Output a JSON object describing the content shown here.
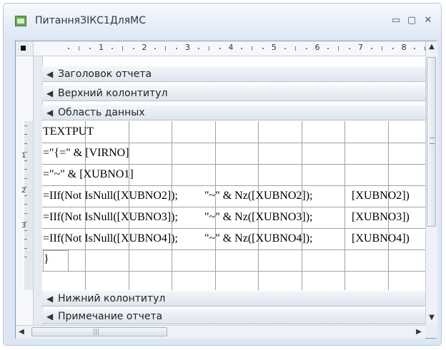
{
  "window": {
    "title": "ПитанняЗІКС1ДляМС",
    "buttons": {
      "minimize": "▭",
      "restore": "▢",
      "close": "✕"
    }
  },
  "ruler": {
    "h_numbers": [
      "1",
      "2",
      "3",
      "4",
      "5",
      "6",
      "7",
      "8"
    ],
    "v_numbers": [
      "1",
      "2",
      "3"
    ]
  },
  "sections": {
    "report_header": "Заголовок отчета",
    "page_header": "Верхний колонтитул",
    "detail": "Область данных",
    "page_footer": "Нижний колонтитул",
    "report_footer": "Примечание отчета"
  },
  "detail_rows": [
    {
      "name": "textput-row",
      "parts": [
        {
          "text": "TEXTPUT",
          "box": 0
        }
      ]
    },
    {
      "name": "virno-row",
      "parts": [
        {
          "text": "=\"{=\" & [VIRNO]",
          "box": 0
        }
      ]
    },
    {
      "name": "xubno1-row",
      "parts": [
        {
          "text": "=\"~\" & [XUBNO1]",
          "box": 0
        }
      ]
    },
    {
      "name": "xubno2-row",
      "parts": [
        {
          "text": "=IIf(Not IsNull([XUBNO2]);",
          "box": 0
        },
        {
          "text": "\"~\" & Nz([XUBNO2]);",
          "box": 1
        },
        {
          "text": "[XUBNO2])",
          "box": 2
        }
      ]
    },
    {
      "name": "xubno3-row",
      "parts": [
        {
          "text": "=IIf(Not IsNull([XUBNO3]);",
          "box": 0
        },
        {
          "text": "\"~\" & Nz([XUBNO3]);",
          "box": 1
        },
        {
          "text": "[XUBNO3])",
          "box": 2
        }
      ]
    },
    {
      "name": "xubno4-row",
      "parts": [
        {
          "text": "=IIf(Not IsNull([XUBNO4]);",
          "box": 0
        },
        {
          "text": "\"~\" & Nz([XUBNO4]);",
          "box": 1
        },
        {
          "text": "[XUBNO4])",
          "box": 2
        }
      ]
    },
    {
      "name": "closing-brace-row",
      "parts": [
        {
          "text": "}",
          "box": 0
        }
      ]
    }
  ],
  "scrollbars": {
    "up": "▲",
    "down": "▼",
    "left": "◀",
    "right": "▶"
  },
  "icons": {
    "app": "report-icon",
    "section_marker": "section-arrow-icon"
  }
}
